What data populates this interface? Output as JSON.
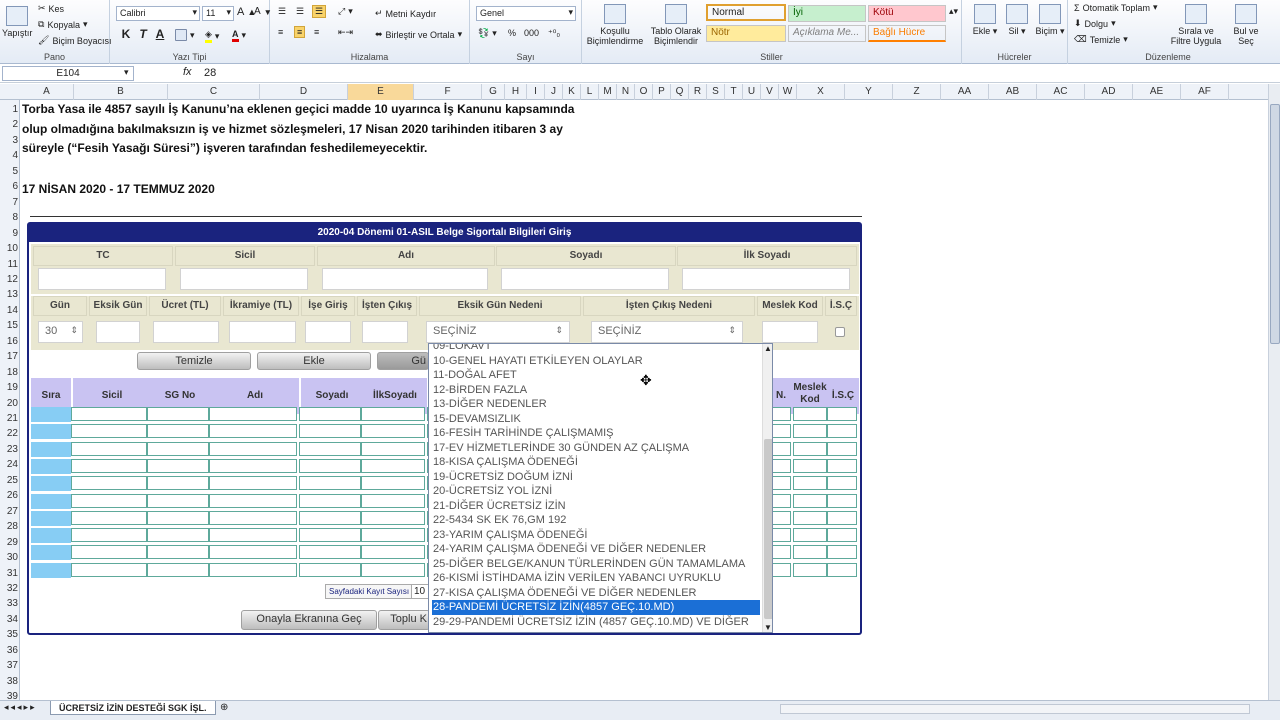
{
  "ribbon": {
    "clipboard": {
      "cut": "Kes",
      "copy": "Kopyala",
      "format_painter": "Biçim Boyacısı",
      "paste": "Yapıştır",
      "group": "Pano"
    },
    "font": {
      "name": "Calibri",
      "size": "11",
      "group": "Yazı Tipi",
      "bold": "K",
      "italic": "T",
      "underline": "A"
    },
    "alignment": {
      "wrap": "Metni Kaydır",
      "merge": "Birleştir ve Ortala",
      "group": "Hizalama"
    },
    "number": {
      "format": "Genel",
      "percent": "%",
      "comma": "000",
      "group": "Sayı"
    },
    "styles": {
      "conditional": "Koşullu Biçimlendirme",
      "table": "Tablo Olarak Biçimlendir",
      "normal": "Normal",
      "good": "İyi",
      "bad": "Kötü",
      "neutral": "Nötr",
      "explanatory": "Açıklama Me...",
      "linked": "Bağlı Hücre",
      "group": "Stiller"
    },
    "cells": {
      "insert": "Ekle",
      "delete": "Sil",
      "format": "Biçim",
      "group": "Hücreler"
    },
    "editing": {
      "autosum": "Otomatik Toplam",
      "fill": "Dolgu",
      "clear": "Temizle",
      "sort": "Sırala ve Filtre Uygula",
      "find": "Bul ve Seç",
      "group": "Düzenleme"
    }
  },
  "formula_bar": {
    "name_box": "E104",
    "fx": "fx",
    "value": "28"
  },
  "columns": [
    "A",
    "B",
    "C",
    "D",
    "E",
    "F",
    "G",
    "H",
    "I",
    "J",
    "K",
    "L",
    "M",
    "N",
    "O",
    "P",
    "Q",
    "R",
    "S",
    "T",
    "U",
    "V",
    "W",
    "X",
    "Y",
    "Z",
    "AA",
    "AB",
    "AC",
    "AD",
    "AE",
    "AF"
  ],
  "rows": [
    "1",
    "2",
    "3",
    "4",
    "5",
    "6",
    "7",
    "8",
    "9",
    "10",
    "11",
    "12",
    "13",
    "14",
    "15",
    "16",
    "17",
    "18",
    "19",
    "20",
    "21",
    "22",
    "23",
    "24",
    "25",
    "26",
    "27",
    "28",
    "29",
    "30",
    "31",
    "32",
    "33",
    "34",
    "35",
    "36",
    "37",
    "38",
    "39"
  ],
  "sheet_text": {
    "line1": "Torba Yasa ile 4857 sayılı İş Kanunu’na eklenen geçici madde 10 uyarınca İş Kanunu kapsamında",
    "line2": "olup olmadığına bakılmaksızın iş ve hizmet sözleşmeleri, 17 Nisan 2020 tarihinden itibaren 3 ay",
    "line3": "süreyle (“Fesih Yasağı Süresi”) işveren tarafından feshedilemeyecektir.",
    "line4": "17 NİSAN 2020 - 17 TEMMUZ 2020"
  },
  "form": {
    "title": "2020-04 Dönemi 01-ASIL Belge Sigortalı Bilgileri Giriş",
    "top_labels": [
      "TC",
      "Sicil",
      "Adı",
      "Soyadı",
      "İlk Soyadı"
    ],
    "mid_labels": [
      "Gün",
      "Eksik Gün",
      "Ücret (TL)",
      "İkramiye (TL)",
      "İşe Giriş",
      "İşten Çıkış",
      "Eksik Gün Nedeni",
      "İşten Çıkış Nedeni",
      "Meslek Kod",
      "İ.S.Ç"
    ],
    "gun_value": "30",
    "eksik_neden_value": "SEÇİNİZ",
    "cikis_neden_value": "SEÇİNİZ",
    "buttons": {
      "clear": "Temizle",
      "add": "Ekle",
      "update": "Gü"
    },
    "grid_headers": [
      "Sıra",
      "Sicil",
      "SG No",
      "Adı",
      "Soyadı",
      "İlkSoyadı"
    ],
    "grid_headers_right": [
      "N.",
      "Meslek Kod",
      "İ.S.Ç"
    ],
    "page_size_label": "Sayfadaki Kayıt Sayısı :",
    "page_size_value": "10",
    "bottom_buttons": {
      "confirm": "Onayla Ekranına Geç",
      "bulk": "Toplu K"
    }
  },
  "dropdown": {
    "options": [
      "09-LOKAVT",
      "10-GENEL HAYATI ETKİLEYEN OLAYLAR",
      "11-DOĞAL AFET",
      "12-BİRDEN FAZLA",
      "13-DİĞER NEDENLER",
      "15-DEVAMSIZLIK",
      "16-FESİH TARİHİNDE ÇALIŞMAMIŞ",
      "17-EV HİZMETLERİNDE 30 GÜNDEN AZ ÇALIŞMA",
      "18-KISA ÇALIŞMA ÖDENEĞİ",
      "19-ÜCRETSİZ DOĞUM İZNİ",
      "20-ÜCRETSİZ YOL İZNİ",
      "21-DİĞER ÜCRETSİZ İZİN",
      "22-5434 SK EK 76,GM 192",
      "23-YARIM ÇALIŞMA ÖDENEĞİ",
      "24-YARIM ÇALIŞMA ÖDENEĞİ VE DİĞER NEDENLER",
      "25-DİĞER BELGE/KANUN TÜRLERİNDEN GÜN TAMAMLAMA",
      "26-KISMİ İSTİHDAMA İZİN VERİLEN YABANCI UYRUKLU",
      "27-KISA ÇALIŞMA ÖDENEĞİ VE DİĞER NEDENLER",
      "28-PANDEMİ ÜCRETSİZ İZİN(4857 GEÇ.10.MD)",
      "29-29-PANDEMİ ÜCRETSİZ İZİN (4857 GEÇ.10.MD) VE DİĞER"
    ],
    "selected_index": 18
  },
  "sheet_tab": "ÜCRETSİZ İZİN DESTEĞİ SGK İŞL."
}
